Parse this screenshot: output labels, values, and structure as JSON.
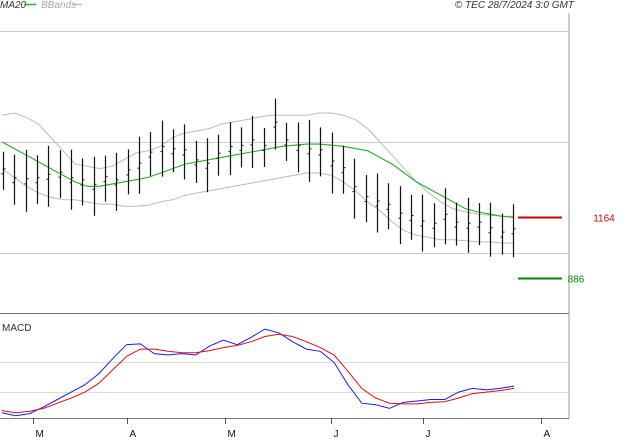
{
  "header": {
    "legend": [
      {
        "label": "MA20",
        "color": "#2bb52b"
      },
      {
        "label": "BBands",
        "color": "#bbbbbb"
      }
    ],
    "copyright": "© TEC 28/7/2024 3:0 GMT"
  },
  "chart_data": [
    {
      "type": "line",
      "panel": "price",
      "yticks": [
        "2000",
        "1500",
        "1000"
      ],
      "ytick_values": [
        2000,
        1500,
        1000
      ],
      "ylim": [
        730,
        2080
      ],
      "x_months": [
        "M",
        "A",
        "M",
        "J",
        "J",
        "A"
      ],
      "grid": true,
      "levels": [
        {
          "label": "1164",
          "value": 1164,
          "color": "#cc0000"
        },
        {
          "label": "886",
          "value": 886,
          "color": "#008800"
        }
      ],
      "series": [
        {
          "name": "MA20",
          "color": "#22b022",
          "values": [
            1500,
            1470,
            1440,
            1410,
            1380,
            1350,
            1320,
            1300,
            1300,
            1310,
            1320,
            1330,
            1340,
            1360,
            1380,
            1400,
            1410,
            1420,
            1430,
            1440,
            1450,
            1460,
            1470,
            1480,
            1485,
            1490,
            1490,
            1485,
            1480,
            1470,
            1460,
            1430,
            1400,
            1360,
            1320,
            1290,
            1260,
            1230,
            1200,
            1185,
            1175,
            1165,
            1160
          ]
        },
        {
          "name": "",
          "color": "#bbbbbb",
          "values": [
            1620,
            1630,
            1610,
            1580,
            1520,
            1460,
            1400,
            1390,
            1380,
            1390,
            1420,
            1450,
            1460,
            1480,
            1520,
            1540,
            1550,
            1560,
            1580,
            1590,
            1600,
            1610,
            1620,
            1620,
            1620,
            1620,
            1630,
            1630,
            1620,
            1600,
            1560,
            1500,
            1440,
            1380,
            1320,
            1270,
            1230,
            1200,
            1185,
            1175,
            1170,
            1165,
            1165
          ]
        },
        {
          "name": "",
          "color": "#bbbbbb",
          "values": [
            1380,
            1340,
            1300,
            1270,
            1250,
            1240,
            1240,
            1230,
            1220,
            1220,
            1210,
            1210,
            1215,
            1230,
            1240,
            1260,
            1270,
            1280,
            1290,
            1300,
            1310,
            1320,
            1330,
            1340,
            1350,
            1360,
            1360,
            1350,
            1320,
            1280,
            1230,
            1190,
            1140,
            1100,
            1080,
            1070,
            1060,
            1060,
            1055,
            1050,
            1050,
            1045,
            1045
          ]
        }
      ],
      "price_bars": [
        1370,
        1330,
        1325,
        1330,
        1345,
        1355,
        1330,
        1320,
        1300,
        1335,
        1320,
        1365,
        1395,
        1445,
        1470,
        1460,
        1455,
        1410,
        1395,
        1440,
        1470,
        1475,
        1500,
        1475,
        1580,
        1500,
        1475,
        1460,
        1455,
        1405,
        1375,
        1290,
        1245,
        1225,
        1210,
        1170,
        1160,
        1135,
        1125,
        1165,
        1130,
        1125,
        1130,
        1105,
        1085,
        1100
      ]
    },
    {
      "type": "line",
      "panel": "macd",
      "title": "MACD",
      "yticks": [
        "20",
        "-20"
      ],
      "ytick_values": [
        20,
        -20
      ],
      "ylim": [
        -55,
        80
      ],
      "x_months": [
        "M",
        "A",
        "M",
        "J",
        "J",
        "A"
      ],
      "series": [
        {
          "name": "",
          "color": "#1a1aff",
          "values": [
            -48,
            -52,
            -49,
            -40,
            -30,
            -20,
            -10,
            5,
            25,
            44,
            45,
            32,
            30,
            32,
            30,
            42,
            50,
            44,
            54,
            65,
            60,
            48,
            38,
            35,
            20,
            -10,
            -35,
            -37,
            -42,
            -34,
            -32,
            -30,
            -30,
            -20,
            -15,
            -17,
            -15,
            -12
          ]
        },
        {
          "name": "",
          "color": "#dd1111",
          "values": [
            -45,
            -48,
            -46,
            -42,
            -35,
            -28,
            -20,
            -8,
            10,
            28,
            38,
            38,
            35,
            33,
            33,
            36,
            40,
            43,
            48,
            55,
            58,
            55,
            48,
            40,
            30,
            8,
            -15,
            -28,
            -35,
            -36,
            -36,
            -34,
            -33,
            -28,
            -22,
            -20,
            -18,
            -15
          ]
        }
      ]
    }
  ]
}
